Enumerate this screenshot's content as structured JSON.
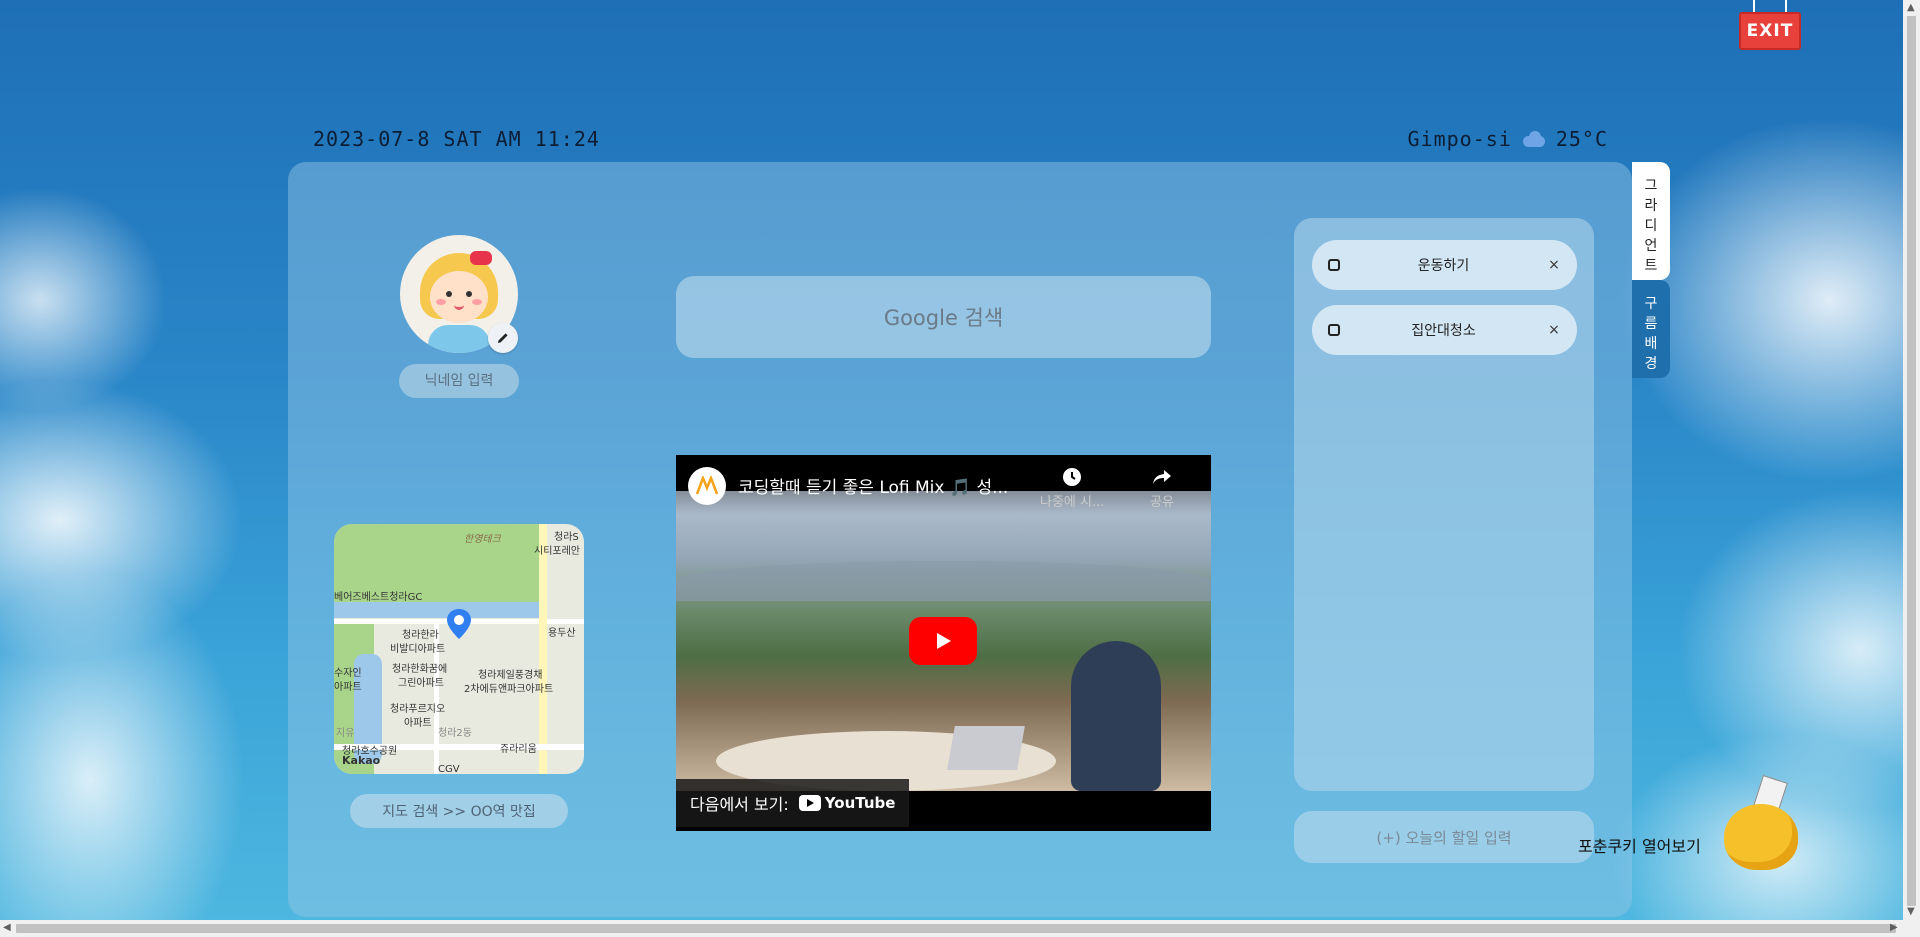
{
  "header": {
    "datetime": "2023-07-8 SAT AM 11:24",
    "location": "Gimpo-si",
    "weather_icon": "cloud-icon",
    "temperature": "25°C"
  },
  "exit_button": {
    "label": "EXIT",
    "color": "#e8413b"
  },
  "side_tabs": [
    {
      "label": "그라디언트",
      "chars": [
        "그",
        "라",
        "디",
        "언",
        "트"
      ],
      "active": true
    },
    {
      "label": "구름배경",
      "chars": [
        "구",
        "름",
        "배",
        "경"
      ],
      "active": false
    }
  ],
  "profile": {
    "avatar_icon": "girl-avatar-icon",
    "edit_icon": "pencil-icon",
    "nickname_button": "닉네임 입력"
  },
  "search": {
    "placeholder": "Google 검색"
  },
  "map": {
    "labels": [
      "한영테크",
      "청라S",
      "시티포레안",
      "베어즈베스트청라GC",
      "청라한라",
      "비발디아파트",
      "청라한화꿈에",
      "그린아파트",
      "수자인",
      "아파트",
      "청라제일풍경채",
      "2차에듀앤파크아파트",
      "청라푸르지오",
      "아파트",
      "청라2동",
      "청라호수공원",
      "쥬라리움",
      "용두산",
      "CGV",
      "지유"
    ],
    "watermark": "Kakao",
    "link_label": "지도 검색 >> OO역 맛집"
  },
  "video": {
    "title": "코딩할때 듣기 좋은 Lofi Mix 🎵 성...",
    "watch_later": "나중에 시...",
    "share": "공유",
    "watch_on": "다음에서 보기:",
    "platform": "YouTube"
  },
  "todos": {
    "items": [
      {
        "text": "운동하기",
        "done": false
      },
      {
        "text": "집안대청소",
        "done": false
      }
    ],
    "delete_symbol": "×",
    "input_placeholder": "(+) 오늘의 할일 입력"
  },
  "fortune": {
    "label": "포춘쿠키 열어보기"
  },
  "colors": {
    "background_top": "#1e6fb6",
    "panel": "rgba(150,200,230,0.45)",
    "active_tab": "#ffffff",
    "inactive_tab": "#1f6fad"
  }
}
